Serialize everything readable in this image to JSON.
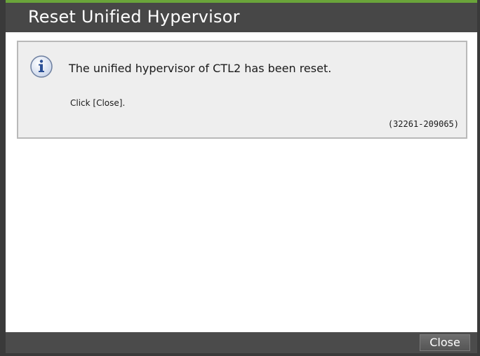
{
  "dialog": {
    "title": "Reset Unified Hypervisor",
    "message": "The unified hypervisor of CTL2 has been reset.",
    "instruction": "Click [Close].",
    "code": "(32261-209065)",
    "icon": "info-icon"
  },
  "footer": {
    "close_label": "Close"
  },
  "colors": {
    "title_bar": "#474747",
    "accent_line": "#6aa43a",
    "message_bg": "#eeeeee",
    "icon_blue": "#2a4f96"
  }
}
